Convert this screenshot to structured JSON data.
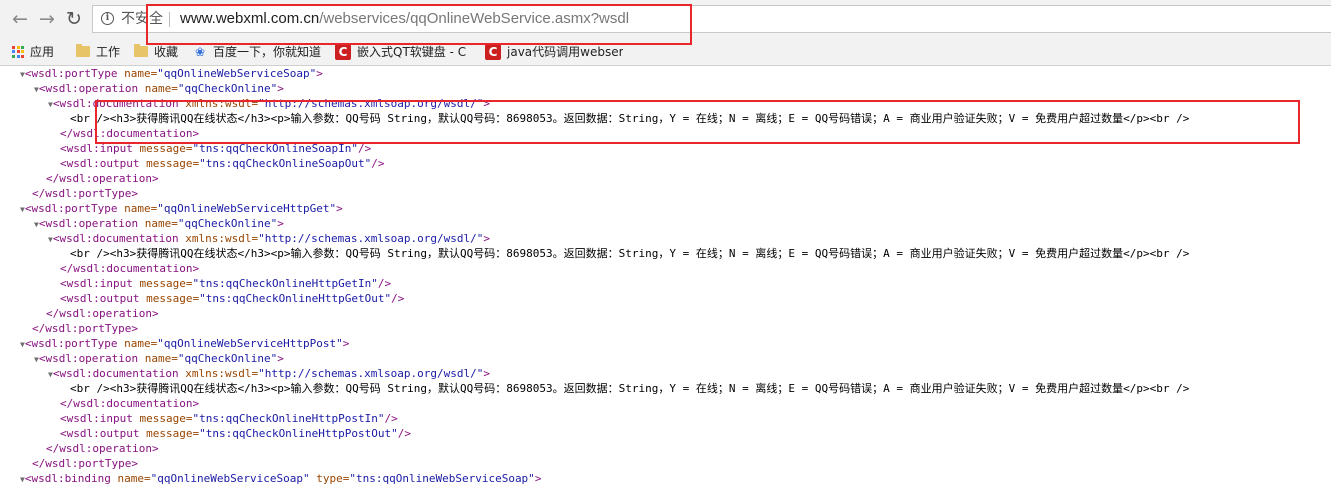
{
  "browser": {
    "security_label": "不安全",
    "url_host": "www.webxml.com.cn",
    "url_path": "/webservices/qqOnlineWebService.asmx?wsdl"
  },
  "bookmarks": [
    {
      "label": "应用",
      "icon": "apps-icon"
    },
    {
      "label": "工作",
      "icon": "folder-icon"
    },
    {
      "label": "收藏",
      "icon": "folder-icon"
    },
    {
      "label": "百度一下，你就知道",
      "icon": "baidu-paw-icon"
    },
    {
      "label": "嵌入式QT软键盘 - C",
      "icon": "csdn-icon"
    },
    {
      "label": "java代码调用webser",
      "icon": "csdn-icon"
    }
  ],
  "xml_lines": [
    {
      "indent": 0,
      "text": "▼<wsdl:portType name=\"qqOnlineWebServiceSoap\">"
    },
    {
      "indent": 1,
      "text": "▼<wsdl:operation name=\"qqCheckOnline\">"
    },
    {
      "indent": 2,
      "text": "▼<wsdl:documentation xmlns:wsdl=\"http://schemas.xmlsoap.org/wsdl/\">"
    },
    {
      "indent": 3,
      "text": "<br /><h3>获得腾讯QQ在线状态</h3><p>输入参数：QQ号码 String，默认QQ号码：8698053。返回数据：String，Y = 在线；N = 离线；E = QQ号码错误；A = 商业用户验证失败；V = 免费用户超过数量</p><br />"
    },
    {
      "indent": 2,
      "text": "</wsdl:documentation>"
    },
    {
      "indent": 2,
      "text": "<wsdl:input message=\"tns:qqCheckOnlineSoapIn\"/>"
    },
    {
      "indent": 2,
      "text": "<wsdl:output message=\"tns:qqCheckOnlineSoapOut\"/>"
    },
    {
      "indent": 1,
      "text": "</wsdl:operation>"
    },
    {
      "indent": 0,
      "text": "</wsdl:portType>"
    },
    {
      "indent": 0,
      "text": "▼<wsdl:portType name=\"qqOnlineWebServiceHttpGet\">"
    },
    {
      "indent": 1,
      "text": "▼<wsdl:operation name=\"qqCheckOnline\">"
    },
    {
      "indent": 2,
      "text": "▼<wsdl:documentation xmlns:wsdl=\"http://schemas.xmlsoap.org/wsdl/\">"
    },
    {
      "indent": 3,
      "text": "<br /><h3>获得腾讯QQ在线状态</h3><p>输入参数：QQ号码 String，默认QQ号码：8698053。返回数据：String，Y = 在线；N = 离线；E = QQ号码错误；A = 商业用户验证失败；V = 免费用户超过数量</p><br />"
    },
    {
      "indent": 2,
      "text": "</wsdl:documentation>"
    },
    {
      "indent": 2,
      "text": "<wsdl:input message=\"tns:qqCheckOnlineHttpGetIn\"/>"
    },
    {
      "indent": 2,
      "text": "<wsdl:output message=\"tns:qqCheckOnlineHttpGetOut\"/>"
    },
    {
      "indent": 1,
      "text": "</wsdl:operation>"
    },
    {
      "indent": 0,
      "text": "</wsdl:portType>"
    },
    {
      "indent": 0,
      "text": "▼<wsdl:portType name=\"qqOnlineWebServiceHttpPost\">"
    },
    {
      "indent": 1,
      "text": "▼<wsdl:operation name=\"qqCheckOnline\">"
    },
    {
      "indent": 2,
      "text": "▼<wsdl:documentation xmlns:wsdl=\"http://schemas.xmlsoap.org/wsdl/\">"
    },
    {
      "indent": 3,
      "text": "<br /><h3>获得腾讯QQ在线状态</h3><p>输入参数：QQ号码 String，默认QQ号码：8698053。返回数据：String，Y = 在线；N = 离线；E = QQ号码错误；A = 商业用户验证失败；V = 免费用户超过数量</p><br />"
    },
    {
      "indent": 2,
      "text": "</wsdl:documentation>"
    },
    {
      "indent": 2,
      "text": "<wsdl:input message=\"tns:qqCheckOnlineHttpPostIn\"/>"
    },
    {
      "indent": 2,
      "text": "<wsdl:output message=\"tns:qqCheckOnlineHttpPostOut\"/>"
    },
    {
      "indent": 1,
      "text": "</wsdl:operation>"
    },
    {
      "indent": 0,
      "text": "</wsdl:portType>"
    },
    {
      "indent": 0,
      "text": "▼<wsdl:binding name=\"qqOnlineWebServiceSoap\" type=\"tns:qqOnlineWebServiceSoap\">"
    }
  ],
  "colors": {
    "highlight_border": "#e8262c",
    "xml_tag": "#881280",
    "xml_attr": "#994500",
    "xml_value": "#1a1aa6"
  }
}
